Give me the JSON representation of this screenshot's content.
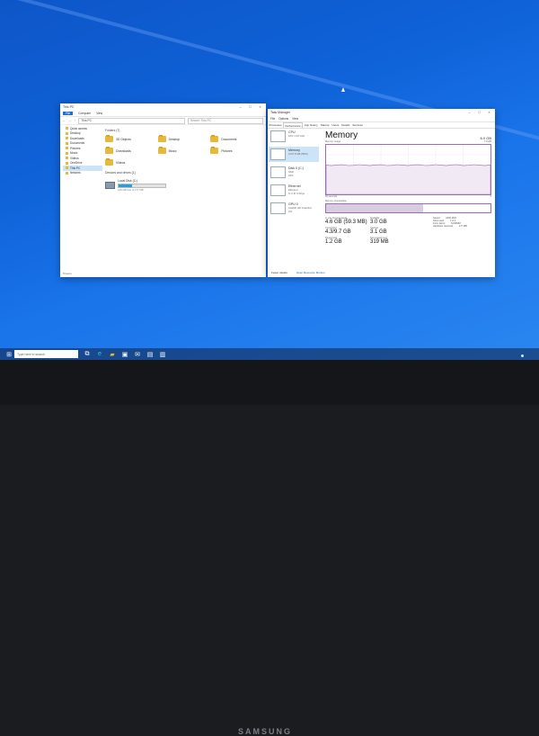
{
  "monitor": {
    "brand": "SAMSUNG"
  },
  "file_explorer": {
    "title": "This PC",
    "ribbon": [
      "File",
      "Computer",
      "View"
    ],
    "address": "This PC",
    "search_placeholder": "Search This PC",
    "nav": [
      "Quick access",
      "Desktop",
      "Downloads",
      "Documents",
      "Pictures",
      "Music",
      "Videos",
      "OneDrive",
      "This PC",
      "Network"
    ],
    "nav_selected": "This PC",
    "folders_header": "Folders (7)",
    "folders": [
      "3D Objects",
      "Desktop",
      "Documents",
      "Downloads",
      "Music",
      "Pictures",
      "Videos"
    ],
    "devices_header": "Devices and drives (1)",
    "drive": {
      "name": "Local Disk (C:)",
      "space": "125 GB free of 177 GB",
      "used_fraction": 0.29
    },
    "status": "8 items"
  },
  "task_manager": {
    "title": "Task Manager",
    "menu": [
      "File",
      "Options",
      "View"
    ],
    "tabs": [
      "Processes",
      "Performance",
      "App history",
      "Startup",
      "Users",
      "Details",
      "Services"
    ],
    "active_tab": "Performance",
    "side": [
      {
        "name": "CPU",
        "sub": "10% 1.43 GHz"
      },
      {
        "name": "Memory",
        "sub": "4.6/7.8 GB (59%)"
      },
      {
        "name": "Disk 0 (C:)",
        "sub": "SSD\n10%"
      },
      {
        "name": "Ethernet",
        "sub": "Ethernet\nS: 0 R: 0 Kbps"
      },
      {
        "name": "GPU 0",
        "sub": "Intel(R) HD Graphics\n2%"
      }
    ],
    "selected": "Memory",
    "panel_title": "Memory",
    "capacity": "8.0 GB",
    "usage_label": "Memory usage",
    "usage_max": "7.8 GB",
    "time_label": "60 seconds",
    "zero_label": "0",
    "composition_label": "Memory composition",
    "stats": [
      {
        "label": "In use (Compressed)",
        "value": "4.6 GB (59.3 MB)"
      },
      {
        "label": "Available",
        "value": "3.0 GB"
      },
      {
        "label": "Committed",
        "value": "4.3/9.7 GB"
      },
      {
        "label": "Cached",
        "value": "3.1 GB"
      },
      {
        "label": "Paged pool",
        "value": "1.2 GB"
      },
      {
        "label": "Non-paged pool",
        "value": "319 MB"
      }
    ],
    "hardware": [
      {
        "k": "Speed:",
        "v": "2400 MHz"
      },
      {
        "k": "Slots used:",
        "v": "1 of 2"
      },
      {
        "k": "Form factor:",
        "v": "SODIMM"
      },
      {
        "k": "Hardware reserved:",
        "v": "177 MB"
      }
    ],
    "usage_fraction": 0.59,
    "footer_less": "Fewer details",
    "footer_link": "Open Resource Monitor"
  },
  "taskbar": {
    "search_placeholder": "Type here to search",
    "icons": [
      "start-icon",
      "search-icon",
      "task-view-icon",
      "edge-icon",
      "file-explorer-icon",
      "store-icon",
      "mail-icon",
      "photos-icon",
      "task-manager-icon"
    ]
  },
  "colors": {
    "desktop": "#0f62d8",
    "accent": "#1f6fd1",
    "memory": "#9a6fb0"
  }
}
